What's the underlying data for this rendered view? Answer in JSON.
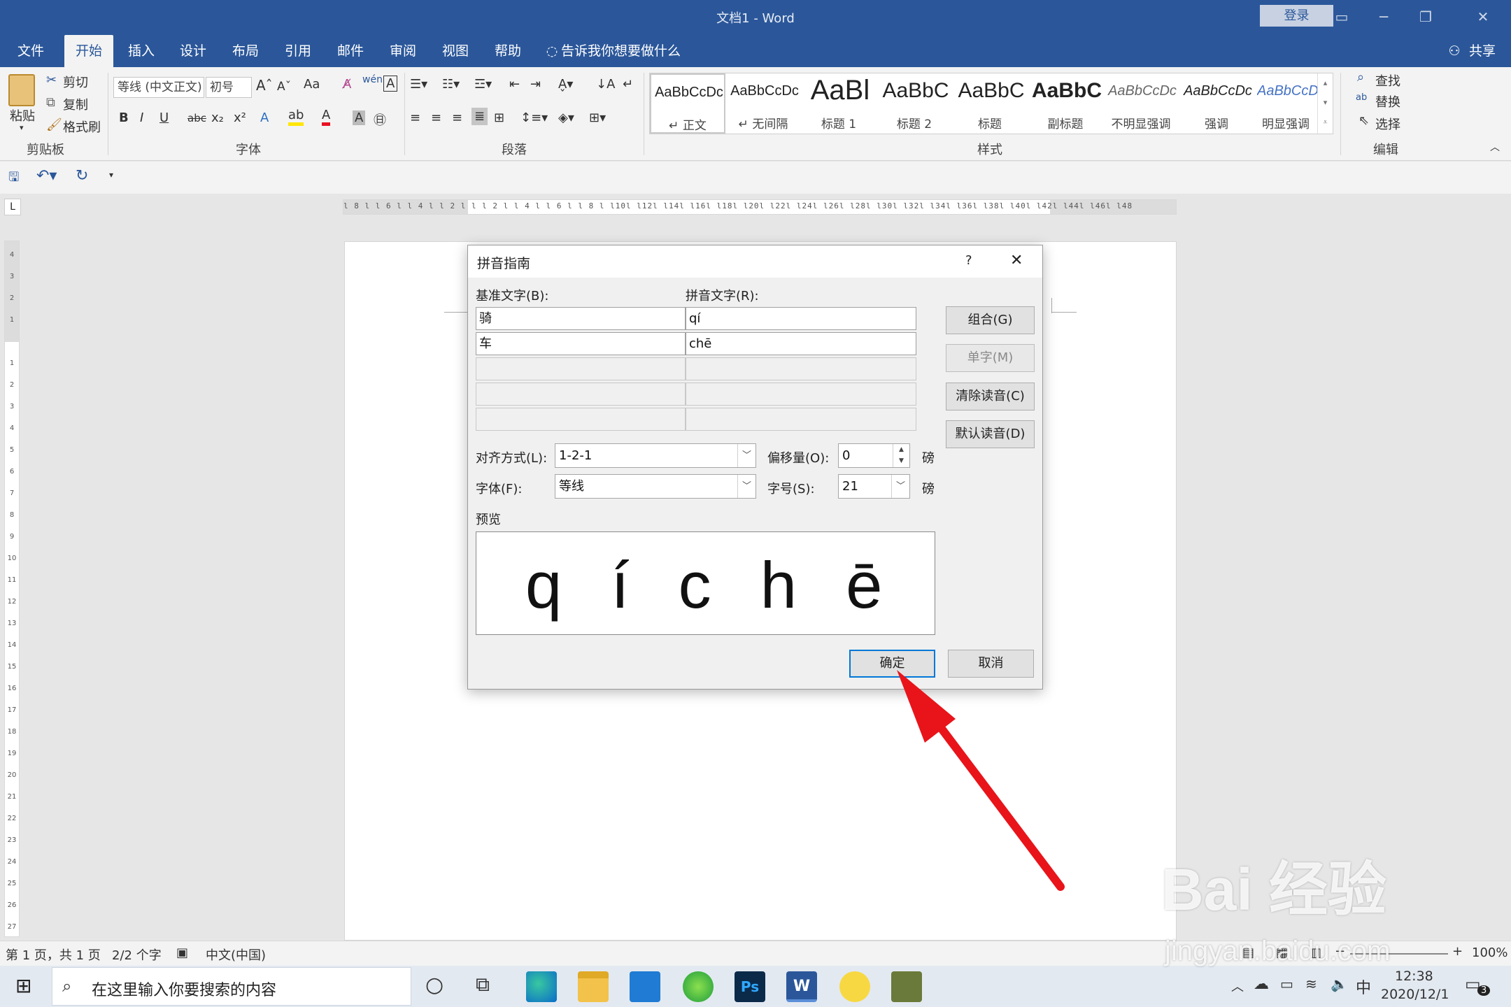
{
  "window": {
    "title": "文档1  -  Word",
    "login": "登录"
  },
  "tabs": [
    "文件",
    "开始",
    "插入",
    "设计",
    "布局",
    "引用",
    "邮件",
    "审阅",
    "视图",
    "帮助"
  ],
  "tell_me": "告诉我你想要做什么",
  "share": "共享",
  "clipboard": {
    "paste": "粘贴",
    "cut": "剪切",
    "copy": "复制",
    "format_painter": "格式刷",
    "label": "剪贴板"
  },
  "font": {
    "name": "等线 (中文正文)",
    "size": "初号",
    "label": "字体",
    "case": "Aa"
  },
  "paragraph": {
    "label": "段落"
  },
  "styles": {
    "label": "样式",
    "items": [
      {
        "sample": "AaBbCcDc",
        "name": "↵ 正文"
      },
      {
        "sample": "AaBbCcDc",
        "name": "↵ 无间隔"
      },
      {
        "sample": "AaBl",
        "name": "标题 1"
      },
      {
        "sample": "AaBbC",
        "name": "标题 2"
      },
      {
        "sample": "AaBbC",
        "name": "标题"
      },
      {
        "sample": "AaBbC",
        "name": "副标题"
      },
      {
        "sample": "AaBbCcDc",
        "name": "不明显强调"
      },
      {
        "sample": "AaBbCcDc",
        "name": "强调"
      },
      {
        "sample": "AaBbCcDc",
        "name": "明显强调"
      }
    ]
  },
  "editing": {
    "find": "查找",
    "replace": "替换",
    "select": "选择",
    "label": "编辑"
  },
  "ruler": {
    "h": "l 8 l  l 6 l  l 4 l  l 2 l   l   l 2 l  l 4 l  l 6 l  l 8 l  l10l  l12l  l14l  l16l  l18l  l20l  l22l  l24l  l26l  l28l  l30l  l32l  l34l  l36l  l38l  l40l  l42l  l44l  l46l  l48",
    "v": [
      "4",
      "3",
      "2",
      "1",
      "",
      "1",
      "2",
      "3",
      "4",
      "5",
      "6",
      "7",
      "8",
      "9",
      "10",
      "11",
      "12",
      "13",
      "14",
      "15",
      "16",
      "17",
      "18",
      "19",
      "20",
      "21",
      "22",
      "23",
      "24",
      "25",
      "26",
      "27"
    ]
  },
  "dialog": {
    "title": "拼音指南",
    "help": "?",
    "base_label": "基准文字(B):",
    "ruby_label": "拼音文字(R):",
    "rows": [
      {
        "base": "骑",
        "ruby": "qí"
      },
      {
        "base": "车",
        "ruby": "chē"
      },
      {
        "base": "",
        "ruby": ""
      },
      {
        "base": "",
        "ruby": ""
      },
      {
        "base": "",
        "ruby": ""
      }
    ],
    "group_btn": "组合(G)",
    "mono_btn": "单字(M)",
    "clear_btn": "清除读音(C)",
    "default_btn": "默认读音(D)",
    "align_label": "对齐方式(L):",
    "align_value": "1-2-1",
    "offset_label": "偏移量(O):",
    "offset_value": "0",
    "font_label": "字体(F):",
    "font_value": "等线",
    "size_label": "字号(S):",
    "size_value": "21",
    "unit": "磅",
    "preview_label": "预览",
    "preview_text": "q  í c h ē",
    "ok": "确定",
    "cancel": "取消"
  },
  "status": {
    "page": "第 1 页，共 1 页",
    "words": "2/2 个字",
    "lang": "中文(中国)",
    "zoom": "100%"
  },
  "taskbar": {
    "search": "在这里输入你要搜索的内容",
    "time": "12:38",
    "date": "2020/12/1",
    "ime": "中",
    "notif": "3"
  },
  "watermark": {
    "main": "Bai 经验",
    "sub": "jingyan.baidu.com"
  },
  "colors": {
    "accent": "#2b579a",
    "arrow": "#e8141a",
    "focus": "#0078d7"
  }
}
